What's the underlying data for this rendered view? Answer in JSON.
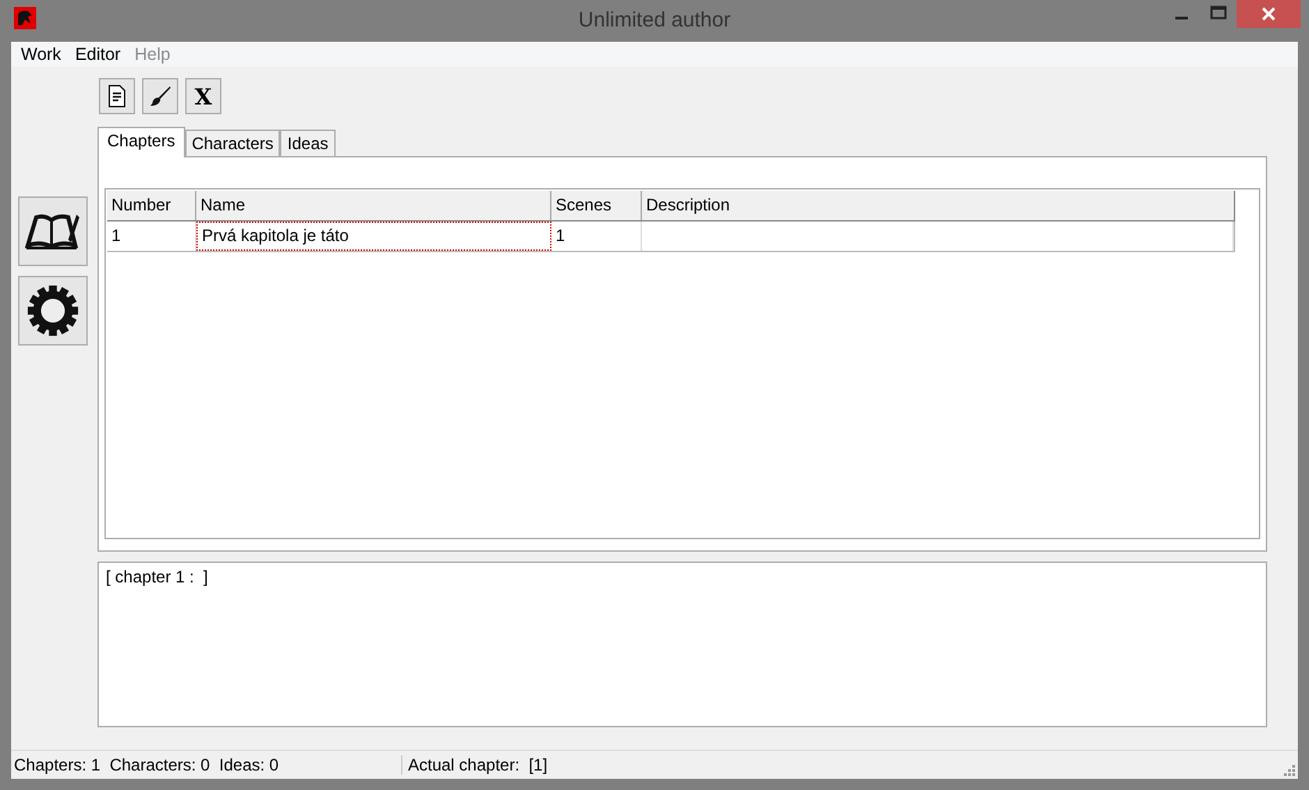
{
  "window": {
    "title": "Unlimited author"
  },
  "menu": [
    {
      "label": "Work",
      "disabled": false
    },
    {
      "label": "Editor",
      "disabled": false
    },
    {
      "label": "Help",
      "disabled": true
    }
  ],
  "toolbar": [
    {
      "kind": "document"
    },
    {
      "kind": "brush"
    },
    {
      "kind": "text",
      "label": "X"
    }
  ],
  "side_buttons": [
    {
      "kind": "book"
    },
    {
      "kind": "gear"
    }
  ],
  "tabs": [
    {
      "label": "Chapters",
      "selected": true
    },
    {
      "label": "Characters",
      "selected": false
    },
    {
      "label": "Ideas",
      "selected": false
    }
  ],
  "table": {
    "columns": [
      "Number",
      "Name",
      "Scenes",
      "Description"
    ],
    "rows": [
      {
        "cells": [
          {
            "text": "1",
            "focused": false
          },
          {
            "text": "Prvá kapitola je táto",
            "focused": true
          },
          {
            "text": "1",
            "focused": false
          },
          {
            "text": "",
            "focused": false
          }
        ]
      }
    ]
  },
  "text_area": {
    "value": "[ chapter 1 :  ]"
  },
  "status_bar": {
    "counts": "Chapters: 1  Characters: 0  Ideas: 0",
    "actual": "Actual chapter:  [1]"
  }
}
